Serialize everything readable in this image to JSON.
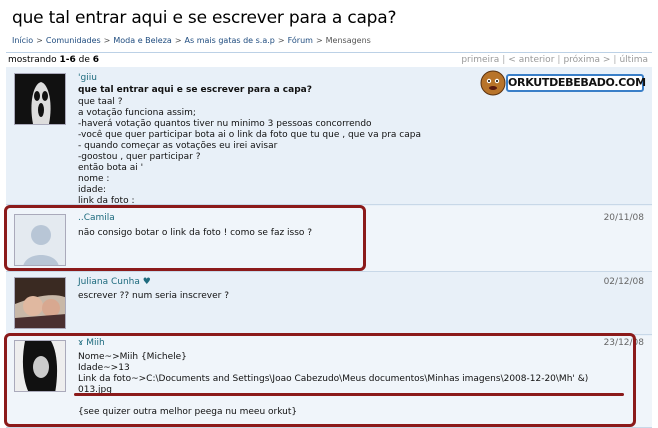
{
  "page": {
    "title": "que tal entrar aqui e se escrever para a capa?"
  },
  "breadcrumb": {
    "items": [
      "Início",
      "Comunidades",
      "Moda e Beleza",
      "As mais gatas de s.a.p",
      "Fórum"
    ],
    "current": "Mensagens",
    "separator": ">"
  },
  "toolbar": {
    "showing_prefix": "mostrando",
    "range": "1-6",
    "of": "de",
    "total": "6",
    "first": "primeira",
    "prev": "< anterior",
    "next": "próxima >",
    "last": "última",
    "sep": "|"
  },
  "logo": {
    "text": "ORKUTDEBEBADO.COM"
  },
  "posts": [
    {
      "author": "'giiu",
      "date": "",
      "title": "que tal entrar aqui e se escrever para a capa?",
      "body": "que taal ?\na votação funciona assim;\n-haverá votação quantos tiver nu minimo 3 pessoas concorrendo\n-você que quer participar bota ai o link da foto que tu que , que va pra capa\n- quando começar as votações eu irei avisar\n-goostou , quer participar ?\nentão bota ai '\nnome :\nidade:\nlink da foto :"
    },
    {
      "author": "..Camila",
      "date": "20/11/08",
      "body": "não consigo botar o link da foto ! como se faz isso ?"
    },
    {
      "author": "Juliana Cunha ♥",
      "date": "02/12/08",
      "body": "escrever ?? num seria inscrever ?"
    },
    {
      "author": "ɤ Miih",
      "date": "23/12/08",
      "body": "Nome~>Miih {Michele}\nIdade~>13\nLink da foto~>C:\\Documents and Settings\\Joao Cabezudo\\Meus documentos\\Minhas imagens\\2008-12-20\\Mh' &)\n013.jpg\n\n{see quizer outra melhor peega nu meeu orkut}"
    }
  ],
  "colors": {
    "link": "#1e4b7e",
    "author": "#1e6b7e",
    "post_bg": "#e8f0f8",
    "highlight": "#8b1a1a"
  }
}
